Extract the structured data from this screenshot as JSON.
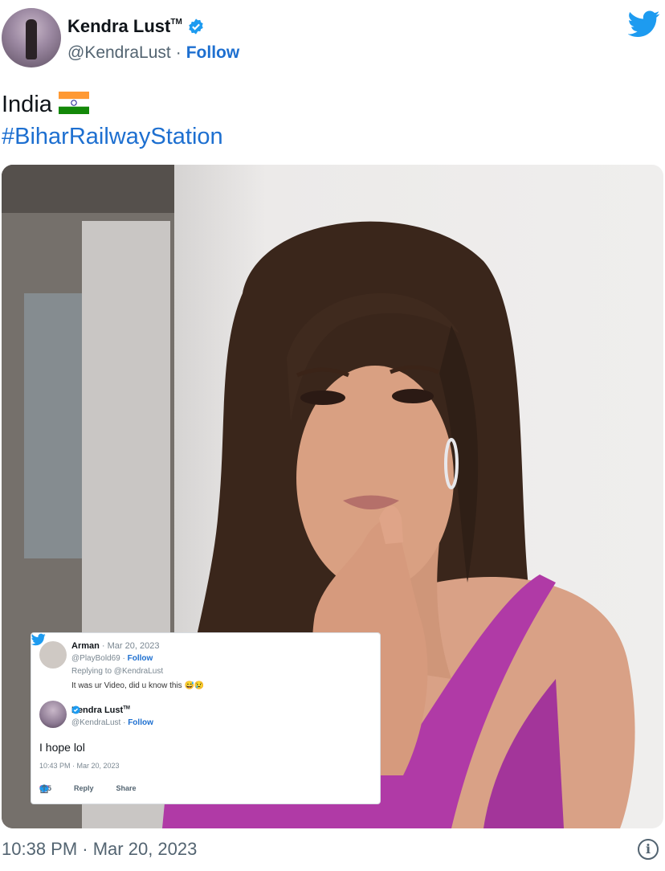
{
  "author": {
    "name": "Kendra Lust",
    "trademark": "TM",
    "handle": "@KendraLust",
    "separator": "·",
    "follow_label": "Follow"
  },
  "tweet": {
    "line1": "India",
    "hashtag": "#BiharRailwayStation"
  },
  "embedded_screenshot": {
    "reply": {
      "name": "Arman",
      "date": "· Mar 20, 2023",
      "handle": "@PlayBold69",
      "follow_label": "Follow",
      "replying_to": "Replying to @KendraLust",
      "text": "It was ur Video, did u know this 😅😢"
    },
    "response": {
      "name": "Kendra Lust",
      "trademark": "TM",
      "handle": "@KendraLust",
      "follow_label": "Follow",
      "text": "I hope lol",
      "timestamp": "10:43 PM · Mar 20, 2023",
      "likes": "615",
      "reply_label": "Reply",
      "share_label": "Share"
    }
  },
  "footer": {
    "timestamp": "10:38 PM · Mar 20, 2023",
    "info_icon": "info-icon"
  },
  "colors": {
    "link": "#1d6fd0",
    "twitter_blue": "#1d9bf0",
    "muted": "#536471"
  }
}
